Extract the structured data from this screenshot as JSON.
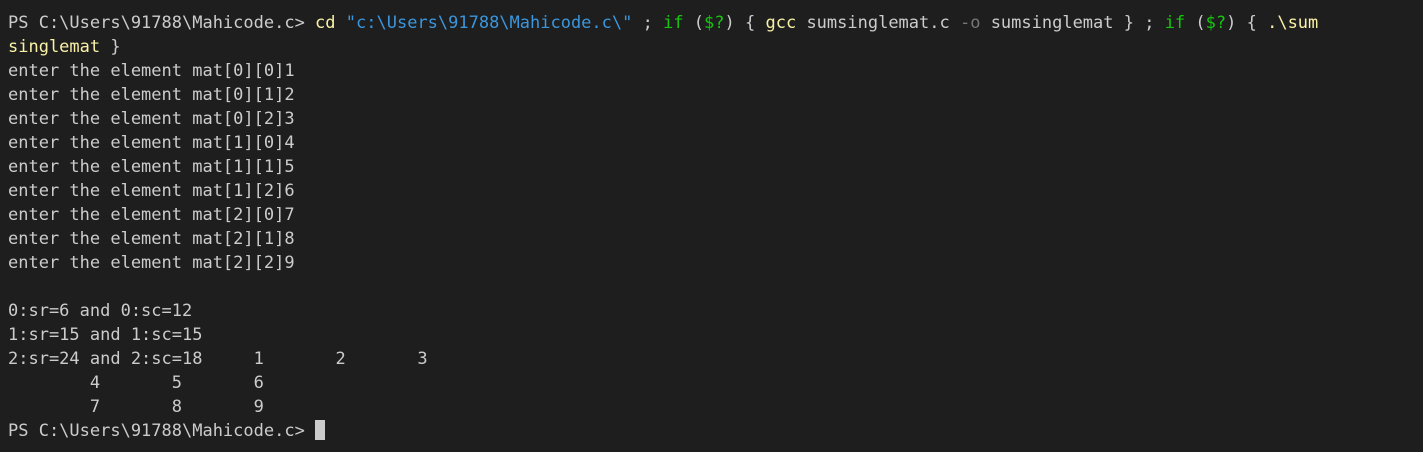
{
  "terminal": {
    "colors": {
      "background": "#1e1e1e",
      "foreground": "#cccccc",
      "command": "#f9f1a5",
      "string": "#3a96dd",
      "keyword": "#16c60c",
      "flag": "#767676"
    },
    "command_line": {
      "prompt": "PS C:\\Users\\91788\\Mahicode.c> ",
      "cd": "cd",
      "path": "\"c:\\Users\\91788\\Mahicode.c\\\"",
      "sep1": " ; ",
      "if1": "if",
      "cond1_open": " (",
      "cond1_var": "$?",
      "cond1_close": ") { ",
      "gcc": "gcc",
      "gcc_args1": " sumsinglemat.c ",
      "gcc_flag": "-o",
      "gcc_args2": " sumsinglemat } ; ",
      "if2": "if",
      "cond2_open": " (",
      "cond2_var": "$?",
      "cond2_close": ") { ",
      "run_part1": ".\\sum",
      "run_part2": "singlemat",
      "run_close": " }"
    },
    "input_lines": [
      "enter the element mat[0][0]1",
      "enter the element mat[0][1]2",
      "enter the element mat[0][2]3",
      "enter the element mat[1][0]4",
      "enter the element mat[1][1]5",
      "enter the element mat[1][2]6",
      "enter the element mat[2][0]7",
      "enter the element mat[2][1]8",
      "enter the element mat[2][2]9"
    ],
    "output_lines": [
      "0:sr=6 and 0:sc=12",
      "1:sr=15 and 1:sc=15",
      "2:sr=24 and 2:sc=18\t1\t2\t3",
      "\t4\t5\t6",
      "\t7\t8\t9"
    ],
    "final_prompt": "PS C:\\Users\\91788\\Mahicode.c> "
  }
}
